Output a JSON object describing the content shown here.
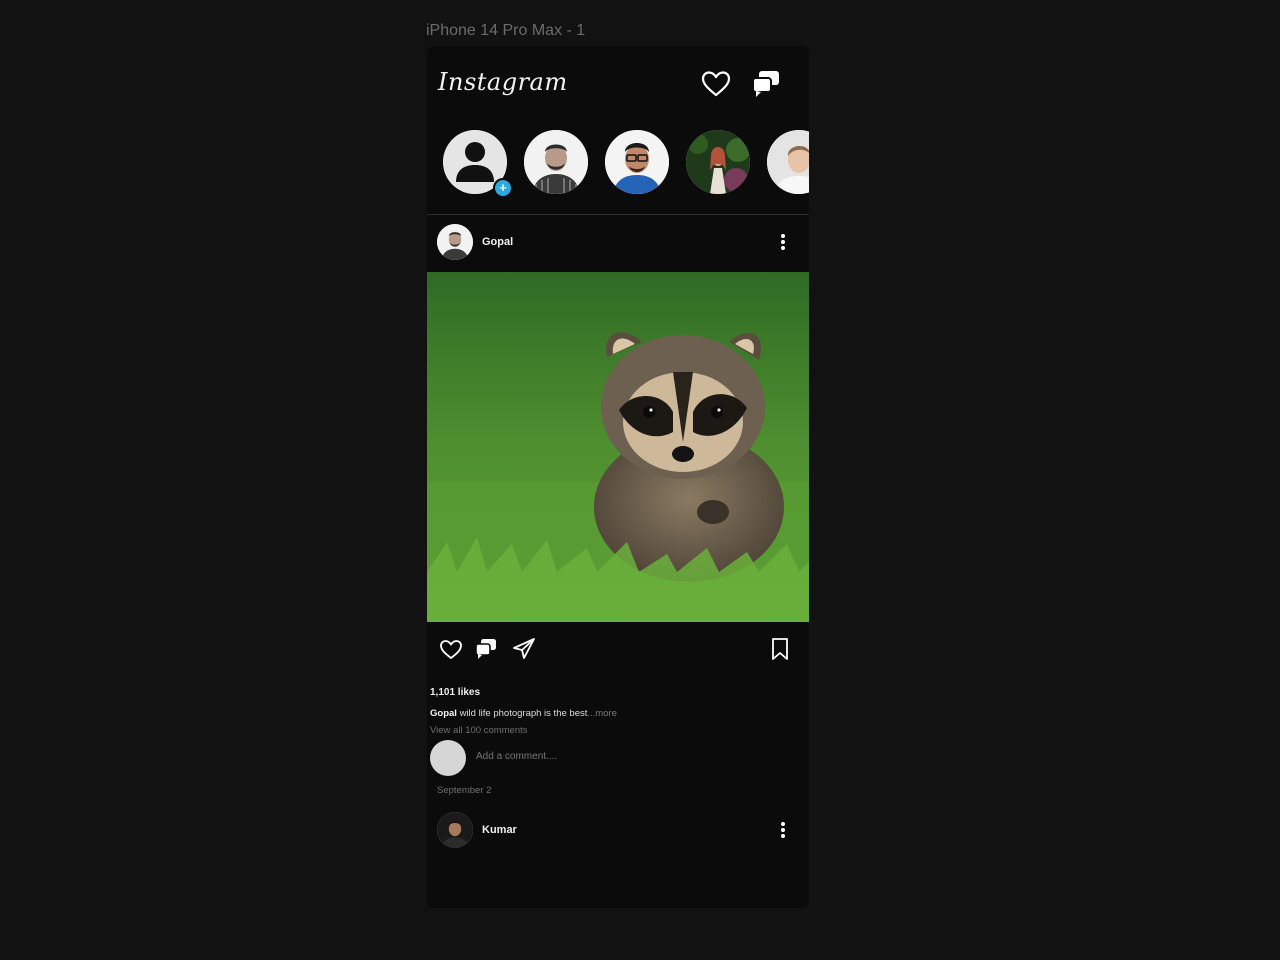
{
  "frame_label": "iPhone 14 Pro Max - 1",
  "app": {
    "logo": "Instagram"
  },
  "header_icons": [
    "heart-icon",
    "messages-icon"
  ],
  "stories": [
    {
      "kind": "own",
      "badge": "+"
    },
    {
      "kind": "photo"
    },
    {
      "kind": "photo"
    },
    {
      "kind": "photo"
    },
    {
      "kind": "photo"
    }
  ],
  "post": {
    "username": "Gopal",
    "likes": "1,101 likes",
    "caption_user": "Gopal",
    "caption_text": "wild life photograph is the best",
    "caption_more": "...more",
    "view_comments": "View all 100 comments",
    "comment_placeholder": "Add a comment....",
    "date": "September 2"
  },
  "next_post": {
    "username": "Kumar"
  },
  "colors": {
    "background": "#121212",
    "phone": "#0c0b0c",
    "accent": "#2aa9e0"
  }
}
